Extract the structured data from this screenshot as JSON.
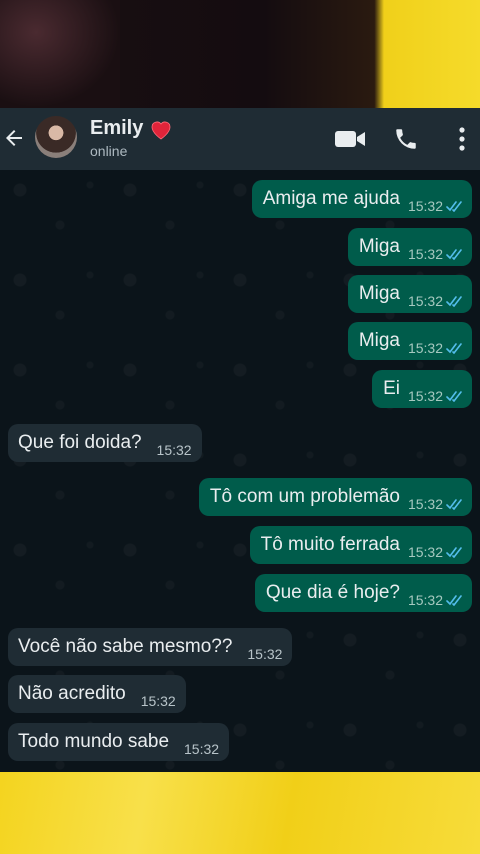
{
  "contact": {
    "name": "Emily",
    "status": "online"
  },
  "messages": [
    {
      "dir": "out",
      "text": "Amiga me ajuda",
      "time": "15:32"
    },
    {
      "dir": "out",
      "text": "Miga",
      "time": "15:32"
    },
    {
      "dir": "out",
      "text": "Miga",
      "time": "15:32"
    },
    {
      "dir": "out",
      "text": "Miga",
      "time": "15:32"
    },
    {
      "dir": "out",
      "text": "Ei",
      "time": "15:32"
    },
    {
      "dir": "in",
      "text": "Que foi doida?",
      "time": "15:32"
    },
    {
      "dir": "out",
      "text": "Tô com um problemão",
      "time": "15:32"
    },
    {
      "dir": "out",
      "text": "Tô muito ferrada",
      "time": "15:32"
    },
    {
      "dir": "out",
      "text": "Que dia é hoje?",
      "time": "15:32"
    },
    {
      "dir": "in",
      "text": "Você não sabe mesmo??",
      "time": "15:32"
    },
    {
      "dir": "in",
      "text": "Não acredito",
      "time": "15:32"
    },
    {
      "dir": "in",
      "text": "Todo mundo sabe",
      "time": "15:32"
    }
  ],
  "colors": {
    "header_bg": "#1f2c34",
    "outgoing_bubble": "#005c4b",
    "incoming_bubble": "#1f2c34",
    "chat_bg": "#0b141a",
    "read_ticks": "#53bdeb",
    "frame_yellow": "#f2d21c"
  },
  "icons": [
    "back-arrow-icon",
    "heart-icon",
    "video-call-icon",
    "phone-icon",
    "more-options-icon",
    "read-ticks-icon"
  ]
}
